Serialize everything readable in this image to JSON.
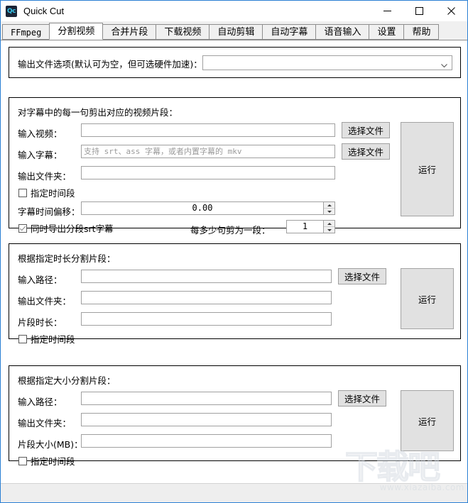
{
  "window": {
    "title": "Quick Cut",
    "icon_label": "Qc",
    "minimize_label": "minimize",
    "maximize_label": "maximize",
    "close_label": "close"
  },
  "tabs": [
    {
      "label": "FFmpeg",
      "active": false
    },
    {
      "label": "分割视频",
      "active": true
    },
    {
      "label": "合并片段",
      "active": false
    },
    {
      "label": "下载视频",
      "active": false
    },
    {
      "label": "自动剪辑",
      "active": false
    },
    {
      "label": "自动字幕",
      "active": false
    },
    {
      "label": "语音输入",
      "active": false
    },
    {
      "label": "设置",
      "active": false
    },
    {
      "label": "帮助",
      "active": false
    }
  ],
  "output_options": {
    "label": "输出文件选项(默认可为空，但可选硬件加速)：",
    "value": "",
    "arrow_icon": "chevron-down-icon"
  },
  "group_subtitle": {
    "title": "对字幕中的每一句剪出对应的视频片段：",
    "input_video_label": "输入视频：",
    "input_video_value": "",
    "input_video_browse": "选择文件",
    "input_subtitle_label": "输入字幕：",
    "input_subtitle_value": "",
    "input_subtitle_placeholder": "支持 srt、ass 字幕，或者内置字幕的 mkv",
    "input_subtitle_browse": "选择文件",
    "output_folder_label": "输出文件夹：",
    "output_folder_value": "",
    "time_range_label": "指定时间段",
    "time_range_checked": false,
    "offset_label": "字幕时间偏移：",
    "offset_value": "0.00",
    "export_srt_label": "同时导出分段srt字幕",
    "export_srt_checked": true,
    "per_sentence_label": "每多少句剪为一段：",
    "per_sentence_value": "1",
    "run_label": "运行"
  },
  "group_duration": {
    "title": "根据指定时长分割片段：",
    "input_path_label": "输入路径：",
    "input_path_value": "",
    "input_path_browse": "选择文件",
    "output_folder_label": "输出文件夹：",
    "output_folder_value": "",
    "segment_duration_label": "片段时长：",
    "segment_duration_value": "",
    "time_range_label": "指定时间段",
    "time_range_checked": false,
    "run_label": "运行"
  },
  "group_size": {
    "title": "根据指定大小分割片段：",
    "input_path_label": "输入路径：",
    "input_path_value": "",
    "input_path_browse": "选择文件",
    "output_folder_label": "输出文件夹：",
    "output_folder_value": "",
    "segment_size_label": "片段大小(MB)：",
    "segment_size_value": "",
    "time_range_label": "指定时间段",
    "time_range_checked": false,
    "run_label": "运行"
  },
  "watermark": {
    "text": "下载吧",
    "url": "www.xiazaiba.com"
  },
  "colors": {
    "window_border": "#2a7fd4",
    "button_face": "#e1e1e1",
    "tabstrip": "#f0f0f0",
    "statusbar": "#eeeeee"
  }
}
